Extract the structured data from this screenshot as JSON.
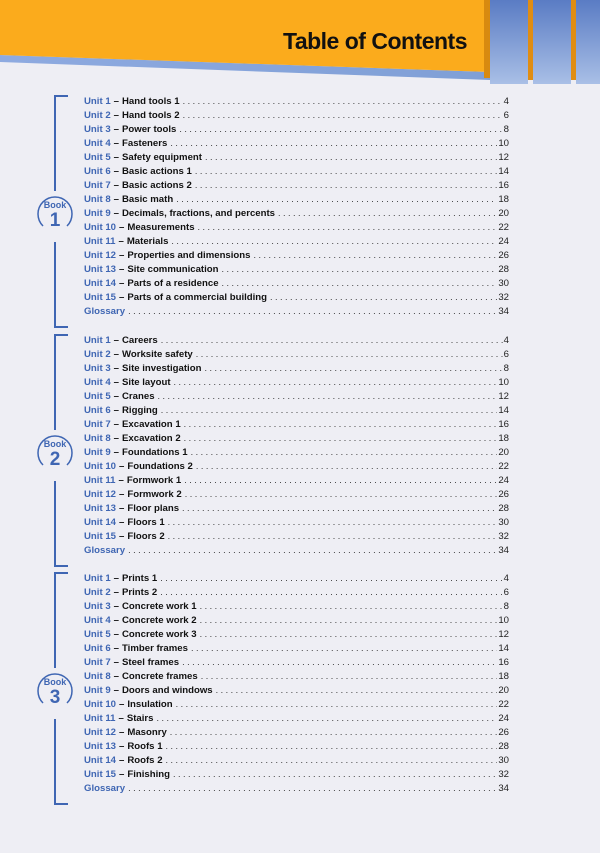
{
  "header": {
    "title": "Table of Contents",
    "colors": {
      "banner": "#fbab1c",
      "accent_blue": "#3f66b3",
      "tab_blue": "#7f9fd6"
    }
  },
  "books": [
    {
      "label": "Book",
      "number": "1",
      "entries": [
        {
          "unit": "Unit 1",
          "title": "Hand tools 1",
          "page": "4"
        },
        {
          "unit": "Unit 2",
          "title": "Hand tools 2",
          "page": "6"
        },
        {
          "unit": "Unit 3",
          "title": "Power tools",
          "page": "8"
        },
        {
          "unit": "Unit 4",
          "title": "Fasteners",
          "page": "10"
        },
        {
          "unit": "Unit 5",
          "title": "Safety equipment",
          "page": "12"
        },
        {
          "unit": "Unit 6",
          "title": "Basic actions 1",
          "page": "14"
        },
        {
          "unit": "Unit 7",
          "title": "Basic actions 2",
          "page": "16"
        },
        {
          "unit": "Unit 8",
          "title": "Basic math",
          "page": "18"
        },
        {
          "unit": "Unit 9",
          "title": "Decimals, fractions, and percents",
          "page": "20"
        },
        {
          "unit": "Unit 10",
          "title": "Measurements",
          "page": "22"
        },
        {
          "unit": "Unit 11",
          "title": "Materials",
          "page": "24"
        },
        {
          "unit": "Unit 12",
          "title": "Properties and dimensions",
          "page": "26"
        },
        {
          "unit": "Unit 13",
          "title": "Site communication",
          "page": "28"
        },
        {
          "unit": "Unit 14",
          "title": "Parts of a residence",
          "page": "30"
        },
        {
          "unit": "Unit 15",
          "title": "Parts of a commercial building",
          "page": "32"
        }
      ],
      "glossary": {
        "label": "Glossary",
        "page": "34"
      }
    },
    {
      "label": "Book",
      "number": "2",
      "entries": [
        {
          "unit": "Unit 1",
          "title": "Careers",
          "page": "4"
        },
        {
          "unit": "Unit 2",
          "title": "Worksite safety",
          "page": "6"
        },
        {
          "unit": "Unit 3",
          "title": "Site investigation",
          "page": "8"
        },
        {
          "unit": "Unit 4",
          "title": "Site layout",
          "page": "10"
        },
        {
          "unit": "Unit 5",
          "title": "Cranes",
          "page": "12"
        },
        {
          "unit": "Unit 6",
          "title": "Rigging",
          "page": "14"
        },
        {
          "unit": "Unit 7",
          "title": "Excavation 1",
          "page": "16"
        },
        {
          "unit": "Unit 8",
          "title": "Excavation 2",
          "page": "18"
        },
        {
          "unit": "Unit 9",
          "title": "Foundations 1",
          "page": "20"
        },
        {
          "unit": "Unit 10",
          "title": "Foundations 2",
          "page": "22"
        },
        {
          "unit": "Unit 11",
          "title": "Formwork 1",
          "page": "24"
        },
        {
          "unit": "Unit 12",
          "title": "Formwork 2",
          "page": "26"
        },
        {
          "unit": "Unit 13",
          "title": "Floor plans",
          "page": "28"
        },
        {
          "unit": "Unit 14",
          "title": "Floors 1",
          "page": "30"
        },
        {
          "unit": "Unit 15",
          "title": "Floors 2",
          "page": "32"
        }
      ],
      "glossary": {
        "label": "Glossary",
        "page": "34"
      }
    },
    {
      "label": "Book",
      "number": "3",
      "entries": [
        {
          "unit": "Unit 1",
          "title": "Prints 1",
          "page": "4"
        },
        {
          "unit": "Unit 2",
          "title": "Prints 2",
          "page": "6"
        },
        {
          "unit": "Unit 3",
          "title": "Concrete work 1",
          "page": "8"
        },
        {
          "unit": "Unit 4",
          "title": "Concrete work 2",
          "page": "10"
        },
        {
          "unit": "Unit 5",
          "title": "Concrete work 3",
          "page": "12"
        },
        {
          "unit": "Unit 6",
          "title": "Timber frames",
          "page": "14"
        },
        {
          "unit": "Unit 7",
          "title": "Steel frames",
          "page": "16"
        },
        {
          "unit": "Unit 8",
          "title": "Concrete frames",
          "page": "18"
        },
        {
          "unit": "Unit 9",
          "title": "Doors and windows",
          "page": "20"
        },
        {
          "unit": "Unit 10",
          "title": "Insulation",
          "page": "22"
        },
        {
          "unit": "Unit 11",
          "title": "Stairs",
          "page": "24"
        },
        {
          "unit": "Unit 12",
          "title": "Masonry",
          "page": "26"
        },
        {
          "unit": "Unit 13",
          "title": "Roofs 1",
          "page": "28"
        },
        {
          "unit": "Unit 14",
          "title": "Roofs 2",
          "page": "30"
        },
        {
          "unit": "Unit 15",
          "title": "Finishing",
          "page": "32"
        }
      ],
      "glossary": {
        "label": "Glossary",
        "page": "34"
      }
    }
  ]
}
